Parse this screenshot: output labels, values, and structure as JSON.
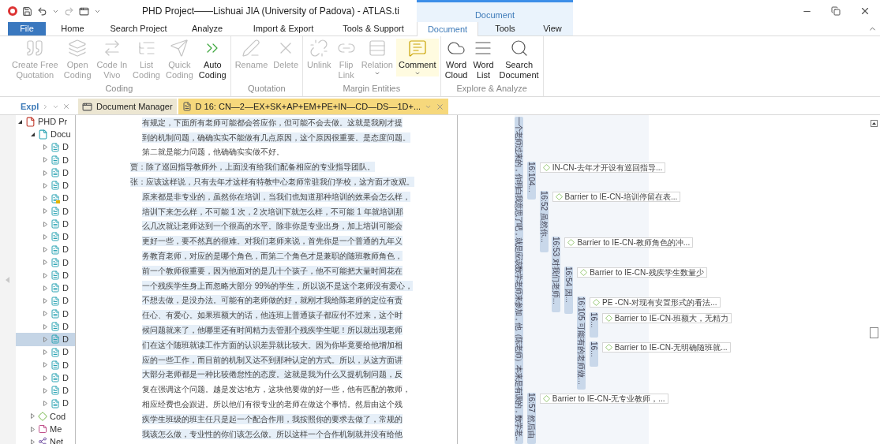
{
  "title_bar": {
    "title": "PHD Project——Lishuai JIA (University of Padova) - ATLAS.ti",
    "context_group": "Document"
  },
  "ribbon_tabs": [
    {
      "label": "File",
      "kind": "file",
      "selected": false
    },
    {
      "label": "Home",
      "kind": "tab",
      "selected": false
    },
    {
      "label": "Search Project",
      "kind": "tab",
      "selected": false
    },
    {
      "label": "Analyze",
      "kind": "tab",
      "selected": false
    },
    {
      "label": "Import & Export",
      "kind": "tab",
      "selected": false
    },
    {
      "label": "Tools & Support",
      "kind": "tab",
      "selected": false
    },
    {
      "label": "Document",
      "kind": "context",
      "selected": true
    },
    {
      "label": "Tools",
      "kind": "context",
      "selected": false
    },
    {
      "label": "View",
      "kind": "context",
      "selected": false
    }
  ],
  "ribbon_groups": [
    {
      "label": "Coding",
      "buttons": [
        {
          "lines": [
            "Create Free",
            "Quotation"
          ],
          "disabled": true,
          "dropdown": false
        },
        {
          "lines": [
            "Open",
            "Coding"
          ],
          "disabled": true,
          "dropdown": false
        },
        {
          "lines": [
            "Code In",
            "Vivo"
          ],
          "disabled": true,
          "dropdown": false
        },
        {
          "lines": [
            "List",
            "Coding"
          ],
          "disabled": true,
          "dropdown": false
        },
        {
          "lines": [
            "Quick",
            "Coding"
          ],
          "disabled": true,
          "dropdown": false
        },
        {
          "lines": [
            "Auto",
            "Coding"
          ],
          "disabled": false,
          "dropdown": false
        }
      ]
    },
    {
      "label": "Quotation",
      "buttons": [
        {
          "lines": [
            "Rename"
          ],
          "disabled": true,
          "dropdown": false
        },
        {
          "lines": [
            "Delete"
          ],
          "disabled": true,
          "dropdown": false
        }
      ]
    },
    {
      "label": "Margin Entities",
      "buttons": [
        {
          "lines": [
            "Unlink"
          ],
          "disabled": true,
          "dropdown": false
        },
        {
          "lines": [
            "Flip",
            "Link"
          ],
          "disabled": true,
          "dropdown": false
        },
        {
          "lines": [
            "Relation"
          ],
          "disabled": true,
          "dropdown": true
        },
        {
          "lines": [
            "Comment"
          ],
          "disabled": false,
          "dropdown": true
        }
      ]
    },
    {
      "label": "Explore & Analyze",
      "buttons": [
        {
          "lines": [
            "Word",
            "Cloud"
          ],
          "disabled": false,
          "dropdown": false
        },
        {
          "lines": [
            "Word",
            "List"
          ],
          "disabled": false,
          "dropdown": false
        },
        {
          "lines": [
            "Search",
            "Document"
          ],
          "disabled": false,
          "dropdown": false
        }
      ]
    }
  ],
  "explorer": {
    "title": "Expl",
    "tree": [
      {
        "label": "PHD Pr",
        "kind": "project",
        "expanded": true,
        "selected": false,
        "children": [
          {
            "label": "Docu",
            "kind": "documents",
            "expanded": true,
            "selected": false,
            "children": [
              {
                "label": "D",
                "kind": "document",
                "selected": false
              },
              {
                "label": "D",
                "kind": "document",
                "selected": false
              },
              {
                "label": "D",
                "kind": "document",
                "selected": false
              },
              {
                "label": "D",
                "kind": "document",
                "selected": false
              },
              {
                "label": "D",
                "kind": "document-memo",
                "selected": false
              },
              {
                "label": "D",
                "kind": "document",
                "selected": false
              },
              {
                "label": "D",
                "kind": "document",
                "selected": false
              },
              {
                "label": "D",
                "kind": "document",
                "selected": false
              },
              {
                "label": "D",
                "kind": "document",
                "selected": false
              },
              {
                "label": "D",
                "kind": "document",
                "selected": false
              },
              {
                "label": "D",
                "kind": "document",
                "selected": false
              },
              {
                "label": "D",
                "kind": "document",
                "selected": false
              },
              {
                "label": "D",
                "kind": "document",
                "selected": false
              },
              {
                "label": "D",
                "kind": "document",
                "selected": false
              },
              {
                "label": "D",
                "kind": "document",
                "selected": false
              },
              {
                "label": "D",
                "kind": "document",
                "selected": true
              },
              {
                "label": "D",
                "kind": "document",
                "selected": false
              },
              {
                "label": "D",
                "kind": "document",
                "selected": false
              },
              {
                "label": "D",
                "kind": "document",
                "selected": false
              },
              {
                "label": "D",
                "kind": "document",
                "selected": false
              },
              {
                "label": "D",
                "kind": "document",
                "selected": false
              }
            ]
          },
          {
            "label": "Cod",
            "kind": "codes",
            "expanded": false,
            "selected": false
          },
          {
            "label": "Me",
            "kind": "memos",
            "expanded": false,
            "selected": false
          },
          {
            "label": "Net",
            "kind": "networks",
            "expanded": false,
            "selected": false
          }
        ]
      }
    ]
  },
  "document_tabs": [
    {
      "label": "Document Manager",
      "kind": "manager",
      "selected": false
    },
    {
      "label": "D 16: CN—2—EX+SK+AP+EM+PE+IN—CD—DS—1D+...",
      "kind": "document",
      "selected": true
    }
  ],
  "document_lines": [
    {
      "text": "有规定，下面所有老师可能都会答应你，但可能不会去做。这就是我刚才提",
      "kind": "continuation",
      "highlighted": true
    },
    {
      "text": "到的机制问题，确确实实不能做有几点原因，这个原因很重要。是态度问题。",
      "kind": "continuation",
      "highlighted": true
    },
    {
      "text": "第二就是能力问题，他确确实实做不好。",
      "kind": "continuation",
      "highlighted": false
    },
    {
      "text": "贾：除了巡回指导教师外，上面没有给我们配备相应的专业指导团队。",
      "kind": "speaker",
      "highlighted": true
    },
    {
      "text": "张：应该这样说，只有去年才这样有特教中心老师常驻我们学校，这方面才改观。",
      "kind": "speaker",
      "highlighted": true
    },
    {
      "text": "原来都是非专业的，虽然你在培训，当我们也知道那种培训的效果会怎么样，",
      "kind": "continuation",
      "highlighted": true
    },
    {
      "text": "培训下来怎么样，不可能 1 次，2 次培训下就怎么样，不可能 1 年就培训那",
      "kind": "continuation",
      "highlighted": true
    },
    {
      "text": "么几次就让老师达到一个很高的水平。除非你是专业出身，加上培训可能会",
      "kind": "continuation",
      "highlighted": true
    },
    {
      "text": "更好一些，要不然真的很难。对我们老师来说，首先你是一个普通的九年义",
      "kind": "continuation",
      "highlighted": true
    },
    {
      "text": "务教育老师，对应的是哪个角色，而第二个角色才是兼职的随班教师角色，",
      "kind": "continuation",
      "highlighted": true
    },
    {
      "text": "前一个教师很重要，因为他面对的是几十个孩子，他不可能把大量时间花在",
      "kind": "continuation",
      "highlighted": true
    },
    {
      "text": "一个残疾学生身上而忽略大部分 99%的学生，所以说不是这个老师没有爱心，",
      "kind": "continuation",
      "highlighted": true
    },
    {
      "text": "不想去做，是没办法。可能有的老师做的好，就刚才我给陈老师的定位有责",
      "kind": "continuation",
      "highlighted": true
    },
    {
      "text": "任心、有爱心。如果班额大的话，他连班上普通孩子都应付不过来，这个时",
      "kind": "continuation",
      "highlighted": true
    },
    {
      "text": "候问题就来了，他哪里还有时间精力去管那个残疾学生呢！所以就出现老师",
      "kind": "continuation",
      "highlighted": true
    },
    {
      "text": "们在这个随班就读工作方面的认识差异就比较大。因为你毕竟要给他增加相",
      "kind": "continuation",
      "highlighted": true
    },
    {
      "text": "应的一些工作，而目前的机制又达不到那种认定的方式。所以，从这方面讲",
      "kind": "continuation",
      "highlighted": true
    },
    {
      "text": "大部分老师都是一种比较倦怠性的态度。这就是我为什么又提机制问题，反",
      "kind": "continuation",
      "highlighted": true
    },
    {
      "text": "复在强调这个问题。越是发达地方，这块他要做的好一些，他有匹配的教师，",
      "kind": "continuation",
      "highlighted": false
    },
    {
      "text": "相应经费也会跟进。所以他们有很专业的老师在做这个事情。然后由这个残",
      "kind": "continuation",
      "highlighted": false
    },
    {
      "text": "疾学生班级的班主任只是起一个配合作用，我按照你的要求去做了，常规的",
      "kind": "continuation",
      "highlighted": true
    },
    {
      "text": "我该怎么做，专业性的你们该怎么做。所以这样一个合作机制就并没有给他",
      "kind": "continuation",
      "highlighted": true
    }
  ],
  "margin": [
    {
      "label": "一个老师过来的，你明白我意思了吧，就是应该数学老师来参加，他（陈老师）本来是有课的，数学老...",
      "children": [
        {
          "label": "16:104...",
          "code": "IN-CN-去年才开设有巡回指导...",
          "children": [
            {
              "label": "16:52 虽然你...",
              "code": "Barrier to IE-CN-培训停留在表...",
              "children": [
                {
                  "label": "16:53 对我们老师...",
                  "code": "Barrier to IE-CN-教师角色的冲...",
                  "children": [
                    {
                      "label": "16:54 因...",
                      "code": "Barrier to IE-CN-残疾学生数量少",
                      "children": [
                        {
                          "label": "16:105 可能有的老师做...",
                          "code": "PE -CN-对现有安置形式的看法...",
                          "children": [
                            {
                              "label": "16...",
                              "code": "Barrier to IE-CN-班额大，无精力"
                            },
                            {
                              "label": "16...",
                              "code": "Barrier to IE-CN-无明确随班就..."
                            }
                          ]
                        }
                      ]
                    }
                  ]
                }
              ]
            }
          ]
        },
        {
          "label": "16:57 然后由",
          "code": "Barrier to IE-CN-无专业教师，..."
        }
      ]
    }
  ]
}
